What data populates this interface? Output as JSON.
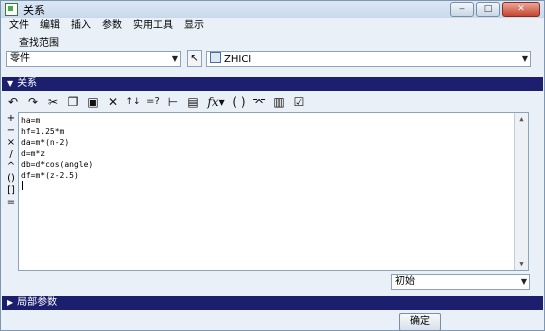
{
  "window": {
    "title": "关系"
  },
  "menu": [
    "文件",
    "编辑",
    "插入",
    "参数",
    "实用工具",
    "显示"
  ],
  "scope": {
    "label": "查找范围",
    "type_value": "零件",
    "model_value": "ZHICI"
  },
  "relations_panel": {
    "title": "关系"
  },
  "editor": {
    "lines": [
      "ha=m",
      "hf=1.25*m",
      "da=m*(n-2)",
      "d=m*z",
      "db=d*cos(angle)",
      "df=m*(z-2.5)"
    ]
  },
  "sidebar_ops": [
    "+",
    "−",
    "×",
    "/",
    "^",
    "()",
    "[]",
    "="
  ],
  "bottom": {
    "sort_value": "初始",
    "local_params_label": "局部参数",
    "ok_label": "确定"
  }
}
